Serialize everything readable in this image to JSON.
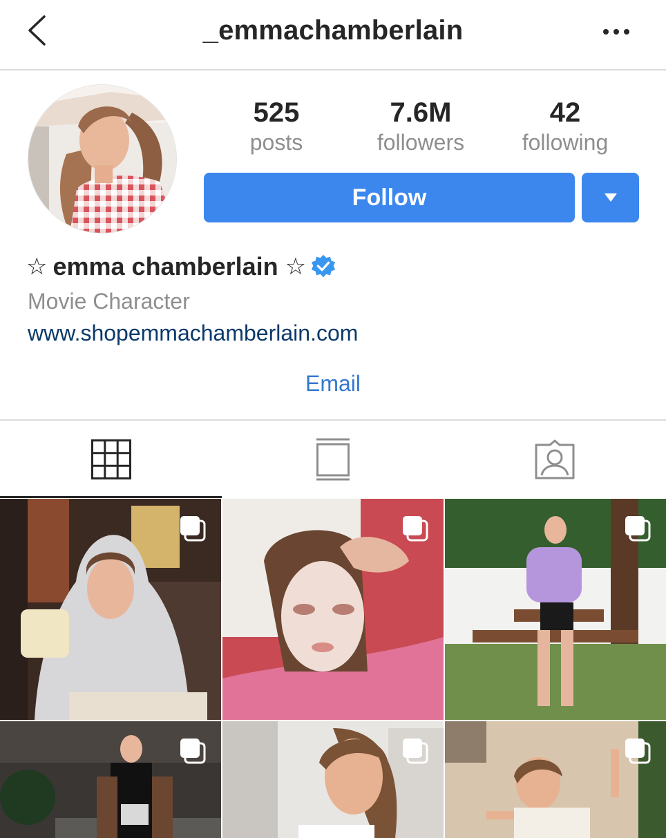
{
  "header": {
    "username": "_emmachamberlain"
  },
  "profile": {
    "posts_count": "525",
    "posts_label": "posts",
    "followers_count": "7.6M",
    "followers_label": "followers",
    "following_count": "42",
    "following_label": "following",
    "follow_label": "Follow"
  },
  "bio": {
    "star_left": "☆",
    "name": "emma chamberlain",
    "star_right": "☆",
    "category": "Movie Character",
    "link": "www.shopemmachamberlain.com",
    "email_label": "Email"
  },
  "tabs": [
    {
      "icon": "grid-icon",
      "active": true
    },
    {
      "icon": "feed-icon",
      "active": false
    },
    {
      "icon": "tagged-icon",
      "active": false
    }
  ],
  "posts": [
    {
      "subject": "hoodie with mug",
      "multi": true
    },
    {
      "subject": "face mask selfie",
      "multi": true
    },
    {
      "subject": "purple top by picnic table",
      "multi": true
    },
    {
      "subject": "black top at night",
      "multi": true
    },
    {
      "subject": "close-up portrait",
      "multi": true
    },
    {
      "subject": "white shirt laughing",
      "multi": true
    }
  ],
  "colors": {
    "accent": "#3b87ee",
    "link": "#0b3a6a",
    "email": "#3378d1",
    "muted": "#8e8e8e",
    "text": "#262626",
    "divider": "#dbdbdb"
  }
}
